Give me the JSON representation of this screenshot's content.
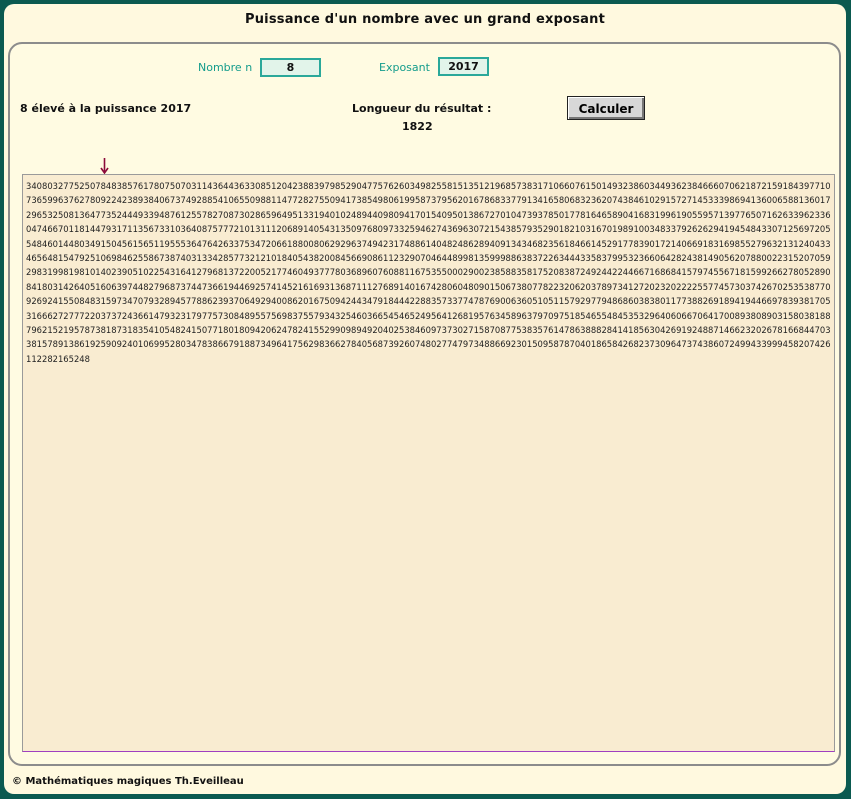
{
  "title": "Puissance d'un  nombre avec un grand exposant",
  "inputs": {
    "n_label": "Nombre n",
    "n_value": "8",
    "exp_label": "Exposant",
    "exp_value": "2017"
  },
  "button": {
    "label": "Calculer"
  },
  "result_header": {
    "caption": "8 élevé à la puissance 2017",
    "length_label": "Longueur du résultat :",
    "length_value": "1822"
  },
  "result_text": "3408032775250784838576178075070311436443633085120423883979852904775762603498255815135121968573831710660761501493238603449362384666070621872159184397710736599637627809224238938406737492885410655098811477282755094173854980619958737956201678683377913416580683236207438461029157271453339869413600658813601729653250813647735244493394876125578270873028659649513319401024894409809417015409501386727010473937850177816465890416831996190559571397765071626339623360474667011814479317113567331036408757772101311120689140543135097680973325946274369630721543857935290182103167019891003483379262629419454843307125697205548460144803491504561565119555364764263375347206618800806292963749423174886140482486289409134346823561846614529177839017214066918316985527963213124043346564815479251069846255867387403133428577321210184054382008456690861123290704644899813599988638372263444335837995323660642824381490562078800223152070592983199819810140239051022543164127968137220052177460493777803689607608811675355000290023858835817520838724924422446671686841579745567181599266278052890841803142640516063974482796873744736619446925741452161693136871112768914016742806048090150673807782232062037897341272023202222557745730374267025353877092692415508483159734707932894577886239370649294008620167509424434791844422883573377478769006360510511579297794868603838011773882691894194466978393817053166627277722037372436614793231797757308489557569837557934325460366545465249564126819576345896379709751854655484535329640606670641700893808903158038188796215219578738187318354105482415077180180942062478241552990989492040253846097373027158708775383576147863888284141856304269192488714662320267816684470338157891386192590924010699528034783866791887349641756298366278405687392607480277479734886692301509587870401865842682373096473743860724994339994582074261122821652​48",
  "footer": "© Mathématiques magiques Th.Eveilleau",
  "colors": {
    "frame": "#0b5a50",
    "label_teal": "#149c8c",
    "field_border": "#2aa89a",
    "arrow": "#8b0a3a"
  }
}
